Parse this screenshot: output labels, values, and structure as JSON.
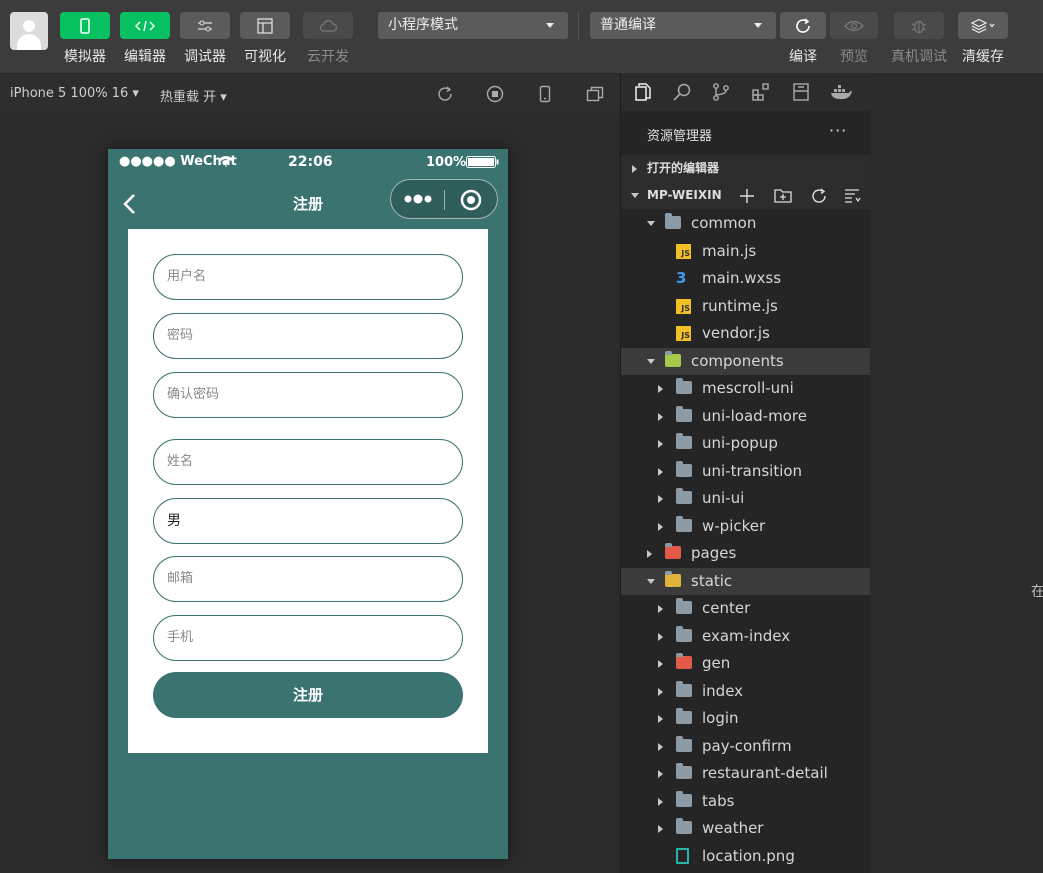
{
  "toolbar": {
    "buttons": [
      {
        "label": "模拟器",
        "style": "green"
      },
      {
        "label": "编辑器",
        "style": "green"
      },
      {
        "label": "调试器",
        "style": "grey"
      },
      {
        "label": "可视化",
        "style": "grey"
      },
      {
        "label": "云开发",
        "style": "dim"
      }
    ],
    "mode_select": "小程序模式",
    "compile_select": "普通编译",
    "right_labels": {
      "compile": "编译",
      "preview": "预览",
      "remote_debug": "真机调试",
      "clear_cache": "清缓存"
    }
  },
  "subbar": {
    "device": "iPhone 5 100% 16",
    "hot_reload": "热重载 开"
  },
  "phone": {
    "carrier": "●●●●● WeChat",
    "time": "22:06",
    "battery": "100%",
    "nav_title": "注册",
    "fields": [
      {
        "placeholder": "用户名",
        "value": ""
      },
      {
        "placeholder": "密码",
        "value": ""
      },
      {
        "placeholder": "确认密码",
        "value": ""
      },
      {
        "placeholder": "姓名",
        "value": ""
      },
      {
        "placeholder": "",
        "value": "男"
      },
      {
        "placeholder": "邮箱",
        "value": ""
      },
      {
        "placeholder": "手机",
        "value": ""
      }
    ],
    "submit_label": "注册"
  },
  "explorer": {
    "title": "资源管理器",
    "more": "···",
    "open_editors": "打开的编辑器",
    "project": "MP-WEIXIN",
    "tree": [
      {
        "label": "common",
        "kind": "folder-open",
        "depth": 1
      },
      {
        "label": "main.js",
        "kind": "js",
        "depth": 2
      },
      {
        "label": "main.wxss",
        "kind": "css",
        "depth": 2
      },
      {
        "label": "runtime.js",
        "kind": "js",
        "depth": 2
      },
      {
        "label": "vendor.js",
        "kind": "js",
        "depth": 2
      },
      {
        "label": "components",
        "kind": "folder-open",
        "depth": 1,
        "highlight": true
      },
      {
        "label": "mescroll-uni",
        "kind": "folder",
        "depth": 2
      },
      {
        "label": "uni-load-more",
        "kind": "folder",
        "depth": 2
      },
      {
        "label": "uni-popup",
        "kind": "folder",
        "depth": 2
      },
      {
        "label": "uni-transition",
        "kind": "folder",
        "depth": 2
      },
      {
        "label": "uni-ui",
        "kind": "folder",
        "depth": 2
      },
      {
        "label": "w-picker",
        "kind": "folder",
        "depth": 2
      },
      {
        "label": "pages",
        "kind": "folder",
        "depth": 1
      },
      {
        "label": "static",
        "kind": "folder-open",
        "depth": 1,
        "highlight": true
      },
      {
        "label": "center",
        "kind": "folder",
        "depth": 2
      },
      {
        "label": "exam-index",
        "kind": "folder",
        "depth": 2
      },
      {
        "label": "gen",
        "kind": "folder",
        "depth": 2
      },
      {
        "label": "index",
        "kind": "folder",
        "depth": 2
      },
      {
        "label": "login",
        "kind": "folder",
        "depth": 2
      },
      {
        "label": "pay-confirm",
        "kind": "folder",
        "depth": 2
      },
      {
        "label": "restaurant-detail",
        "kind": "folder",
        "depth": 2
      },
      {
        "label": "tabs",
        "kind": "folder",
        "depth": 2
      },
      {
        "label": "weather",
        "kind": "folder",
        "depth": 2
      },
      {
        "label": "location.png",
        "kind": "png",
        "depth": 2
      }
    ]
  },
  "right_pane": {
    "partial_char": "在"
  },
  "colors": {
    "accent_green": "#07c160",
    "theme_teal": "#3a7370",
    "js_yellow": "#f1bf26",
    "css_blue": "#3d9be9"
  }
}
